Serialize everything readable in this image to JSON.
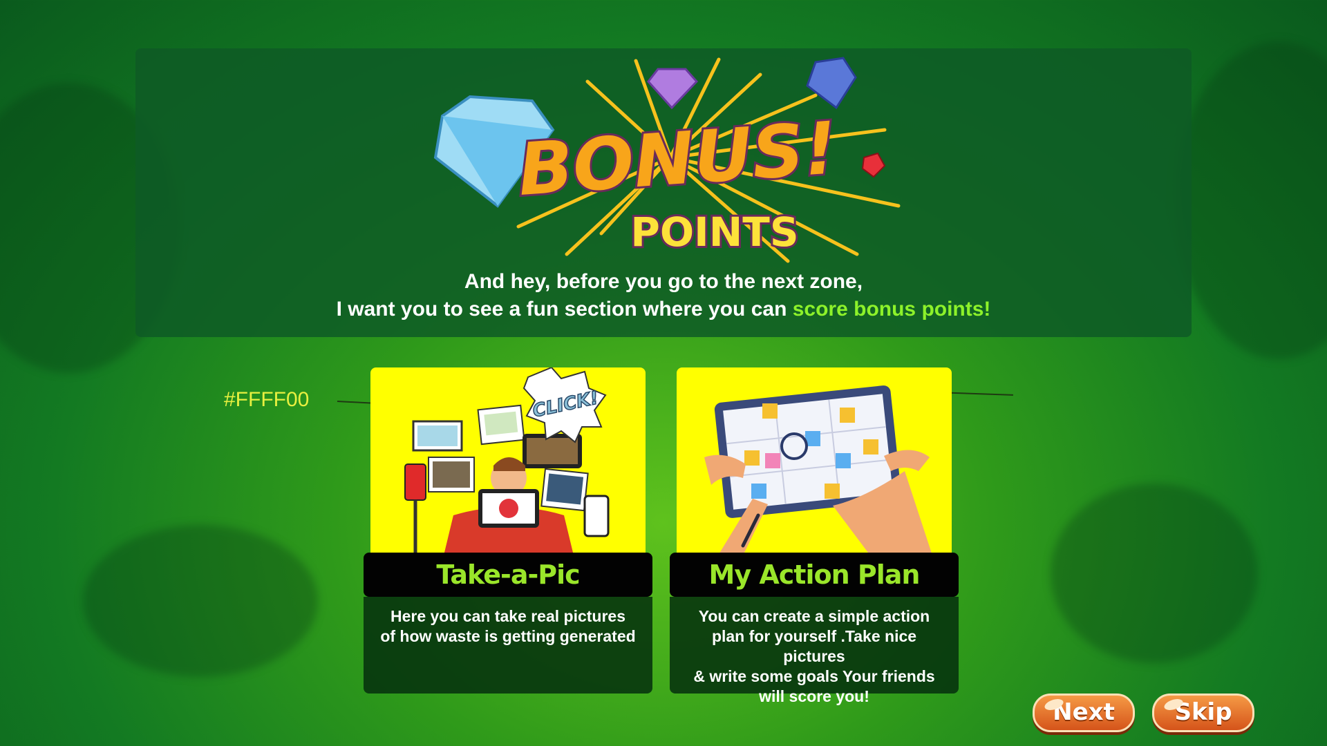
{
  "logo": {
    "word1": "BONUS!",
    "word2": "POINTS"
  },
  "intro": {
    "line1": "And hey, before you go to the next zone,",
    "line2_plain": "I want you to see a fun section where you can ",
    "line2_highlight": "score bonus points!"
  },
  "annotation": {
    "hex_label": "#FFFF00"
  },
  "cards": [
    {
      "title": "Take-a-Pic",
      "description": "Here you can take real pictures\nof how waste is getting generated",
      "bubble_text": "CLICK!"
    },
    {
      "title": "My Action Plan",
      "description": "You can create a simple action\nplan for yourself .Take nice pictures\n& write some goals Your friends\nwill score you!"
    }
  ],
  "buttons": {
    "next": "Next",
    "skip": "Skip"
  },
  "colors": {
    "card_background": "#FFFF00",
    "card_title": "#9AE62A",
    "highlight": "#8DF22A",
    "button": "#E8722E"
  }
}
